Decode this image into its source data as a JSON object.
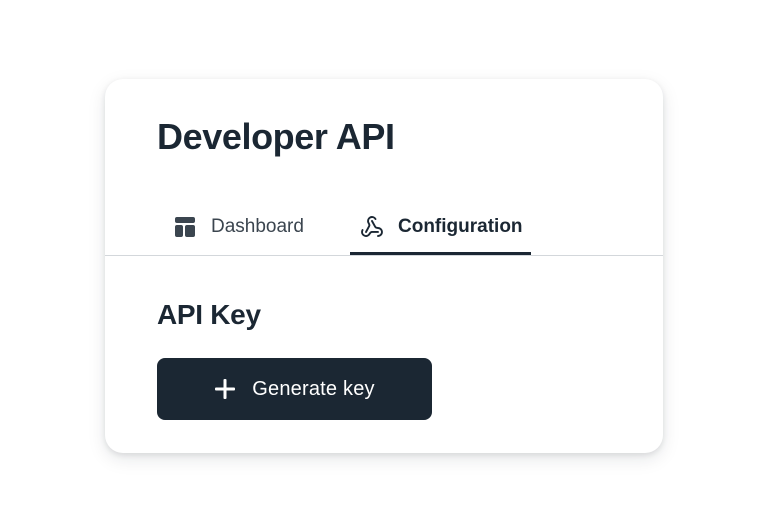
{
  "header": {
    "title": "Developer API"
  },
  "tabs": [
    {
      "label": "Dashboard",
      "icon": "dashboard-layout-icon",
      "active": false
    },
    {
      "label": "Configuration",
      "icon": "webhook-icon",
      "active": true
    }
  ],
  "api_key_section": {
    "title": "API Key",
    "generate_button": {
      "label": "Generate key",
      "icon": "plus-icon"
    }
  },
  "colors": {
    "primary": "#1b2733",
    "divider": "#d3d7db",
    "inactive_tab_text": "#3b454f",
    "background": "#ffffff"
  }
}
